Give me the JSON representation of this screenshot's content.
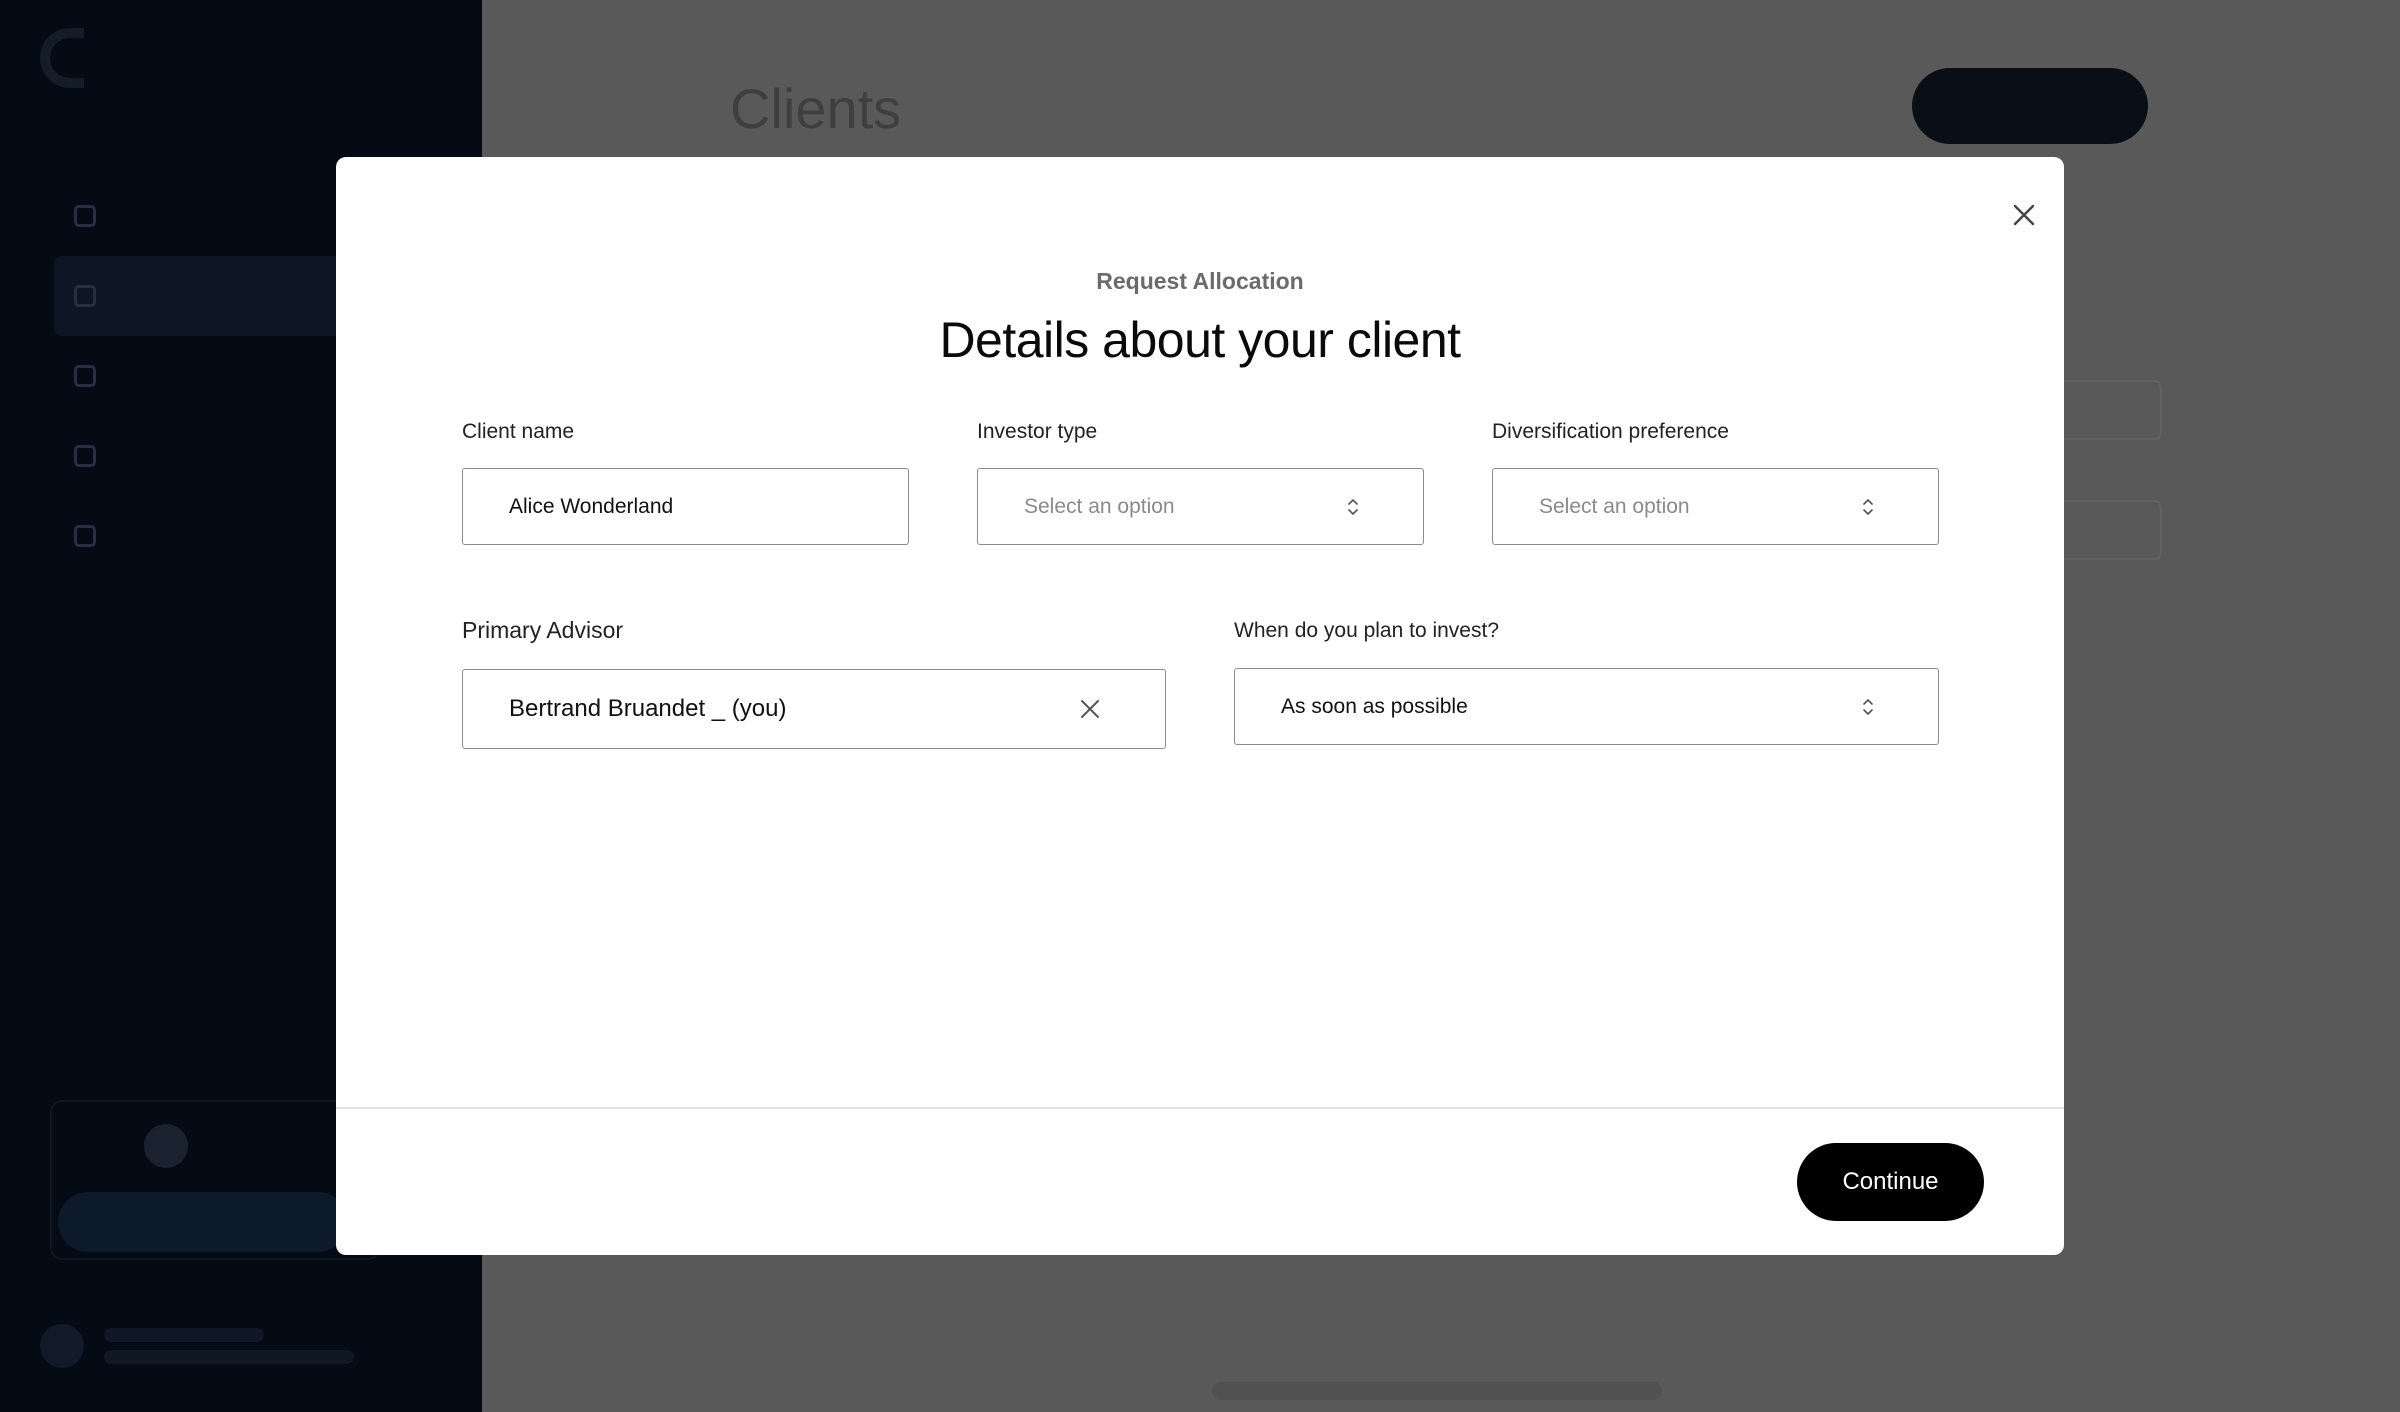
{
  "background": {
    "page_title": "Clients"
  },
  "modal": {
    "eyebrow": "Request Allocation",
    "title": "Details about your client",
    "client_name": {
      "label": "Client name",
      "value": "Alice Wonderland"
    },
    "investor_type": {
      "label": "Investor type",
      "placeholder": "Select an option"
    },
    "diversification": {
      "label": "Diversification preference",
      "placeholder": "Select an option"
    },
    "primary_advisor": {
      "label": "Primary Advisor",
      "value": "Bertrand Bruandet _ (you)"
    },
    "invest_timing": {
      "label": "When do you plan to invest?",
      "value": "As soon as possible"
    },
    "continue_label": "Continue"
  },
  "icons": {
    "close": "close-icon",
    "select_chevron": "chevron-up-down-icon",
    "clear": "clear-icon"
  },
  "colors": {
    "primary_button": "#000000",
    "sidebar": "#050b14",
    "overlay": "#5a5a5a"
  }
}
